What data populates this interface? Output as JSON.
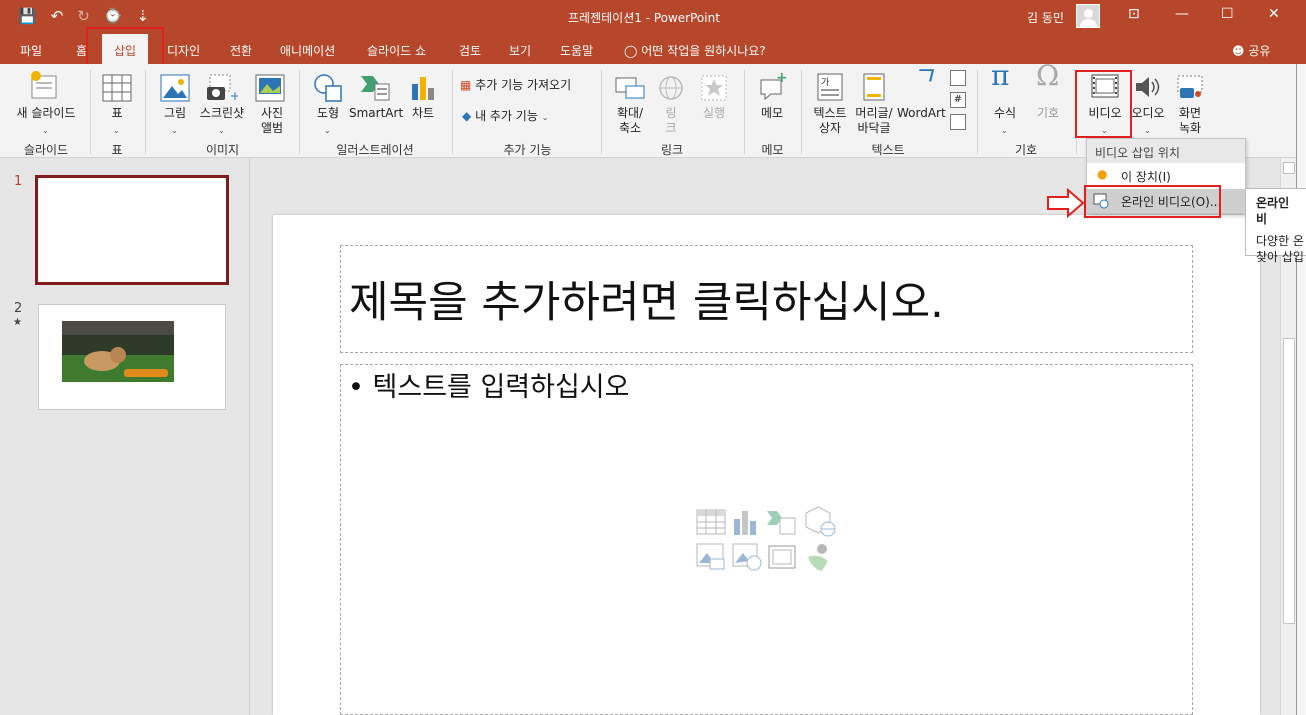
{
  "window": {
    "title": "프레젠테이션1  -  PowerPoint",
    "user": "김 동민",
    "minimize": "—",
    "maximize": "☐",
    "close": "✕",
    "ribbon_display": "⊡"
  },
  "qat": {
    "save_icon": "💾",
    "undo_icon": "↶",
    "redo_icon": "↻",
    "present_icon": "⌚",
    "customize_icon": "⇣"
  },
  "tabs": [
    "파일",
    "홈",
    "삽입",
    "디자인",
    "전환",
    "애니메이션",
    "슬라이드 쇼",
    "검토",
    "보기",
    "도움말"
  ],
  "active_tab": "삽입",
  "tell_me": "어떤 작업을 원하시나요?",
  "share": "공유",
  "ribbon": {
    "slides": {
      "new_slide": "새 슬라이드",
      "group": "슬라이드"
    },
    "tables": {
      "table": "표",
      "group": "표"
    },
    "images": {
      "picture": "그림",
      "screenshot": "스크린샷",
      "album": "사진\n앨범",
      "group": "이미지"
    },
    "illustrations": {
      "shapes": "도형",
      "smartart": "SmartArt",
      "chart": "차트",
      "group": "일러스트레이션"
    },
    "addins": {
      "get": "추가 기능 가져오기",
      "my": "내 추가 기능",
      "group": "추가 기능"
    },
    "links": {
      "zoom": "확대/\n축소",
      "link": "링\n크",
      "action": "실행",
      "group": "링크"
    },
    "comments": {
      "comment": "메모",
      "group": "메모"
    },
    "text": {
      "textbox": "텍스트\n상자",
      "header": "머리글/\n바닥글",
      "wordart": "WordArt",
      "group": "텍스트"
    },
    "symbols": {
      "equation": "수식",
      "symbol": "기호",
      "group": "기호"
    },
    "media": {
      "video": "비디오",
      "audio": "오디오",
      "record": "화면\n녹화"
    }
  },
  "dropdown": {
    "header": "비디오 삽입 위치",
    "items": [
      "이 장치(I)",
      "온라인 비디오(O)..."
    ]
  },
  "tooltip": {
    "title": "온라인 비",
    "body": "다양한 온\n찾아 삽입"
  },
  "slides": [
    {
      "num": "1"
    },
    {
      "num": "2",
      "star": "★"
    }
  ],
  "slide": {
    "title_placeholder": "제목을 추가하려면 클릭하십시오.",
    "body_placeholder": "• 텍스트를 입력하십시오"
  }
}
